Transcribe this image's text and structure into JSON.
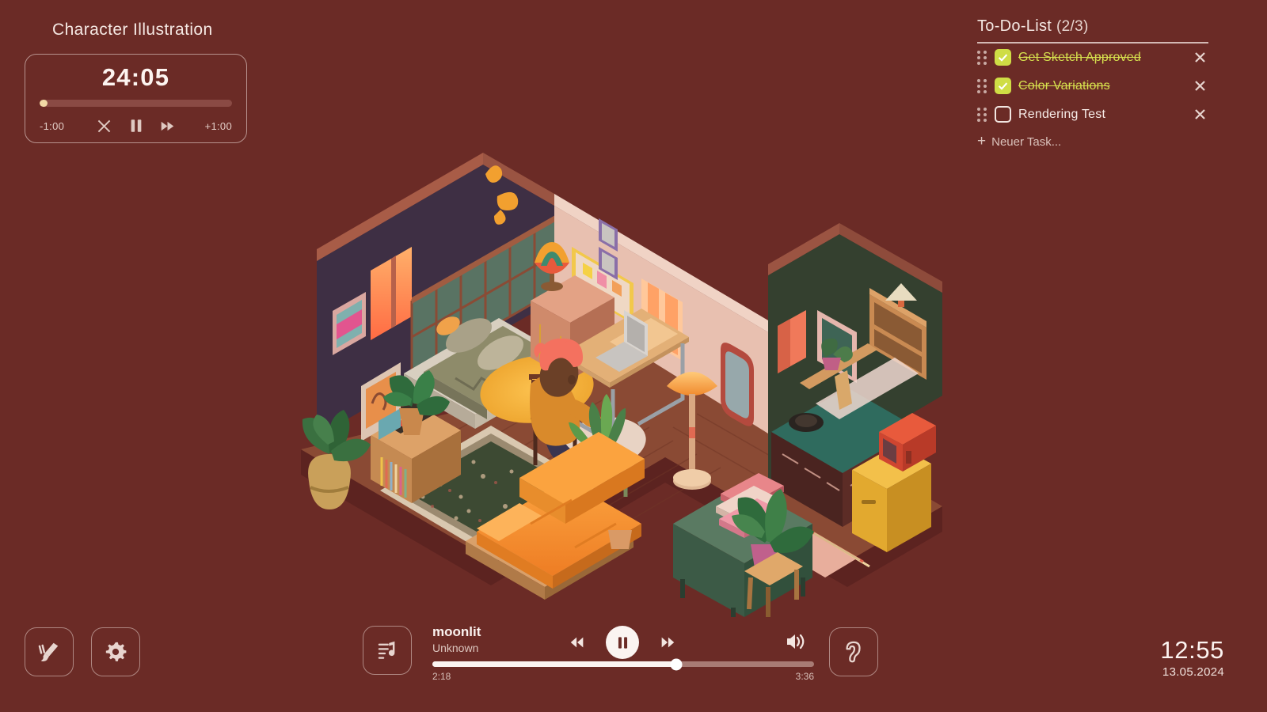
{
  "session": {
    "title": "Character Illustration"
  },
  "timer": {
    "value": "24:05",
    "progress_percent": 4,
    "decrement_label": "-1:00",
    "increment_label": "+1:00",
    "buttons": {
      "reset": "reset-timer",
      "pause": "pause-timer",
      "skip": "skip-timer"
    }
  },
  "todo": {
    "title": "To-Do-List",
    "count": "(2/3)",
    "completed": 2,
    "total": 3,
    "add_label": "Neuer Task...",
    "add_symbol": "+",
    "checked_color": "#cfdd45",
    "done_text_color": "#d6e04e",
    "items": [
      {
        "label": "Get Sketch Approved",
        "done": true
      },
      {
        "label": "Color Variations",
        "done": true
      },
      {
        "label": "Rendering Test",
        "done": false
      }
    ]
  },
  "toolbar": {
    "theme_icon": "paintbrush-icon",
    "settings_icon": "gear-icon",
    "ambient_icon": "ear-icon"
  },
  "player": {
    "track_title": "moonlit",
    "artist": "Unknown",
    "elapsed": "2:18",
    "duration": "3:36",
    "progress_percent": 64,
    "art_icon": "music-note-list-icon",
    "state": "playing",
    "controls": {
      "previous": "previous-track",
      "play_pause": "pause",
      "next": "next-track",
      "volume": "volume-high"
    }
  },
  "clock": {
    "time": "12:55",
    "date": "13.05.2024"
  },
  "scene": {
    "name": "isometric-cozy-apartment",
    "description": "Isometric cutaway apartment: bedroom loft with green glass partition, study desk with character on laptop, kitchenette and living area with sofa and rug",
    "palette": {
      "background": "#6b2b26",
      "bedroom_wall": "#3e2f44",
      "study_wall": "#e8c0b0",
      "kitchen_wall": "#34402f",
      "floor_wood": "#8a4a34",
      "sofa_orange": "#f59333",
      "window_glow": "#ff7f4f",
      "character_sweater": "#d98a2b",
      "character_hair": "#f4715f",
      "fridge_yellow": "#e8ae34",
      "counter_teal": "#2f6b5e",
      "rug_green": "#3d4a33"
    }
  }
}
